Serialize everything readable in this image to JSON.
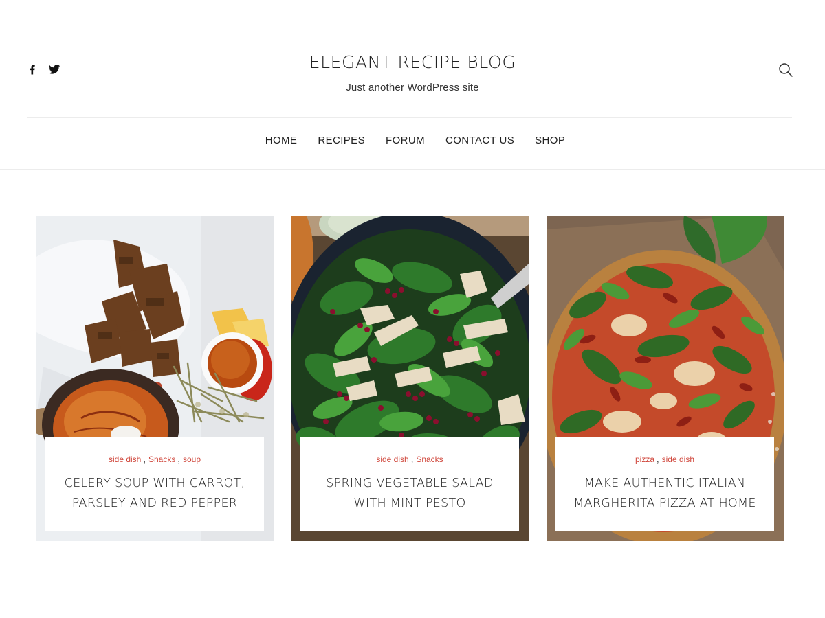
{
  "header": {
    "site_title": "ELEGANT RECIPE BLOG",
    "tagline": "Just another WordPress site",
    "social": [
      {
        "icon": "facebook-icon"
      },
      {
        "icon": "twitter-icon"
      }
    ],
    "search_icon": "search-icon"
  },
  "nav": {
    "items": [
      {
        "label": "HOME"
      },
      {
        "label": "RECIPES"
      },
      {
        "label": "FORUM"
      },
      {
        "label": "CONTACT US"
      },
      {
        "label": "SHOP"
      }
    ]
  },
  "posts": [
    {
      "categories": [
        "side dish",
        "Snacks",
        "soup"
      ],
      "separators": [
        ",",
        ","
      ],
      "title": "CELERY SOUP WITH CARROT, PARSLEY AND RED PEPPER",
      "image": "celery soup with bread and honey"
    },
    {
      "categories": [
        "side dish",
        "Snacks"
      ],
      "separators": [
        ","
      ],
      "title": "SPRING VEGETABLE SALAD WITH MINT PESTO",
      "image": "spinach salad with chicken and pomegranate"
    },
    {
      "categories": [
        "pizza",
        "side dish"
      ],
      "separators": [
        ","
      ],
      "title": "MAKE AUTHENTIC ITALIAN MARGHERITA PIZZA AT HOME",
      "image": "pizza topped with arugula and tomatoes"
    }
  ],
  "colors": {
    "category_accent": "#d0473c",
    "text": "#222222",
    "divider": "#ececec"
  }
}
